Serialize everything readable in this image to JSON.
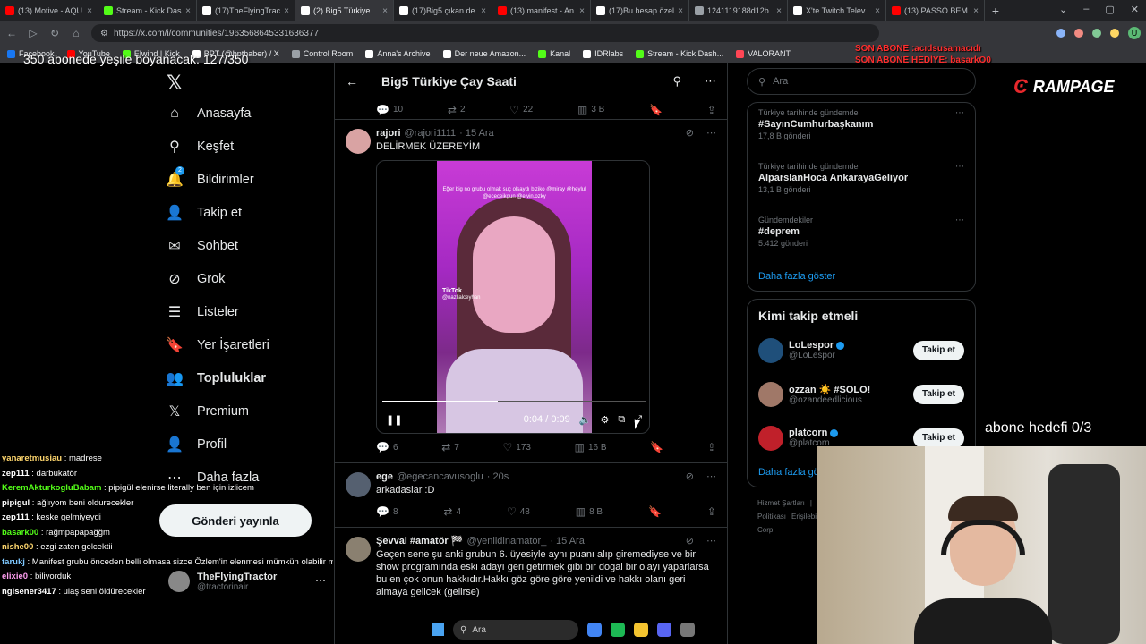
{
  "browser": {
    "tabs": [
      {
        "label": "(13) Motive - AQU",
        "color": "#ff0000"
      },
      {
        "label": "Stream - Kick Dash",
        "color": "#53fc18"
      },
      {
        "label": "(17)TheFlyingTrac",
        "color": "#ffffff"
      },
      {
        "label": "(2) Big5 Türkiye",
        "color": "#ffffff"
      },
      {
        "label": "(17)Big5 çıkan de",
        "color": "#ffffff"
      },
      {
        "label": "(13) manifest - An",
        "color": "#ff0000"
      },
      {
        "label": "(17)Bu hesap özel",
        "color": "#ffffff"
      },
      {
        "label": "1241119188d12b",
        "color": "#9aa0a6"
      },
      {
        "label": "X'te Twitch Telev",
        "color": "#ffffff"
      },
      {
        "label": "(13) PASSO BEM",
        "color": "#ff0000"
      }
    ],
    "active_tab": 3,
    "url": "https://x.com/i/communities/1963568645331636377",
    "bookmarks": [
      {
        "label": "Facebook",
        "color": "#1877f2"
      },
      {
        "label": "YouTube",
        "color": "#ff0000"
      },
      {
        "label": "Elwind | Kick",
        "color": "#53fc18"
      },
      {
        "label": "BPT (@bpthaber) / X",
        "color": "#ffffff"
      },
      {
        "label": "Control Room",
        "color": "#9aa0a6"
      },
      {
        "label": "Anna's Archive",
        "color": "#ffffff"
      },
      {
        "label": "Der neue Amazon...",
        "color": "#ffffff"
      },
      {
        "label": "Kanal",
        "color": "#53fc18"
      },
      {
        "label": "IDRlabs",
        "color": "#ffffff"
      },
      {
        "label": "Stream - Kick Dash...",
        "color": "#53fc18"
      },
      {
        "label": "VALORANT",
        "color": "#ff4655"
      }
    ]
  },
  "nav": {
    "items": [
      {
        "label": "Anasayfa",
        "icon": "home-icon",
        "glyph": "⌂"
      },
      {
        "label": "Keşfet",
        "icon": "search-icon",
        "glyph": "⚲"
      },
      {
        "label": "Bildirimler",
        "icon": "bell-icon",
        "glyph": "🔔"
      },
      {
        "label": "Takip et",
        "icon": "follow-icon",
        "glyph": "👤"
      },
      {
        "label": "Sohbet",
        "icon": "mail-icon",
        "glyph": "✉"
      },
      {
        "label": "Grok",
        "icon": "grok-icon",
        "glyph": "⊘"
      },
      {
        "label": "Listeler",
        "icon": "list-icon",
        "glyph": "☰"
      },
      {
        "label": "Yer İşaretleri",
        "icon": "bookmark-icon",
        "glyph": "🔖"
      },
      {
        "label": "Topluluklar",
        "icon": "communities-icon",
        "glyph": "👥"
      },
      {
        "label": "Premium",
        "icon": "x-icon",
        "glyph": "𝕏"
      },
      {
        "label": "Profil",
        "icon": "profile-icon",
        "glyph": "👤"
      },
      {
        "label": "Daha fazla",
        "icon": "more-icon",
        "glyph": "⋯"
      }
    ],
    "notif_count": "2",
    "post_button": "Gönderi yayınla",
    "account": {
      "name": "TheFlyingTractor",
      "handle": "@tractorinair"
    }
  },
  "center": {
    "title": "Big5 Türkiye Çay Saati",
    "prev_actions": {
      "reply": "10",
      "repost": "2",
      "like": "22",
      "views": "3 B"
    },
    "tweets": [
      {
        "name": "rajori",
        "handle": "@rajori1111",
        "time": "· 15 Ara",
        "text": "DELİRMEK ÜZEREYİM",
        "avatar_color": "#d9a3a3",
        "video": {
          "caption": "Eğer big no grubu olmak suç olsaydı biziko @miray @heylul @ececeikgun @elvin.ozky",
          "tiktok": "TikTok",
          "tiktok_handle": "@nazlialceyhan",
          "time": "0:04 / 0:09",
          "progress": 0.44
        },
        "actions": {
          "reply": "6",
          "repost": "7",
          "like": "173",
          "views": "16 B"
        }
      },
      {
        "name": "ege",
        "handle": "@egecancavusoglu",
        "time": "· 20s",
        "text": "arkadaslar :D",
        "avatar_color": "#556070",
        "actions": {
          "reply": "8",
          "repost": "4",
          "like": "48",
          "views": "8 B"
        }
      },
      {
        "name": "Şevval #amatör 🏁",
        "handle": "@yenildinamator_",
        "time": "· 15 Ara",
        "text": "Geçen sene şu anki grubun 6. üyesiyle aynı puanı alıp giremediyse ve bir show programında eski adayı geri getirmek gibi bir dogal bir olayı yaparlarsa bu en çok onun hakkıdır.Hakkı göz göre göre yenildi ve hakkı olanı geri almaya gelicek (gelirse)",
        "avatar_color": "#8a8070"
      }
    ]
  },
  "right": {
    "search_placeholder": "Ara",
    "trends": [
      {
        "context": "Türkiye tarihinde gündemde",
        "title": "#SayınCumhurbaşkanım",
        "count": "17,8 B gönderi"
      },
      {
        "context": "Türkiye tarihinde gündemde",
        "title": "AlparslanHoca AnkarayaGeliyor",
        "count": "13,1 B gönderi"
      },
      {
        "context": "Gündemdekiler",
        "title": "#deprem",
        "count": "5.412 gönderi"
      }
    ],
    "show_more": "Daha fazla göster",
    "who_to_follow_title": "Kimi takip etmeli",
    "follow": [
      {
        "name": "LoLespor",
        "handle": "@LoLespor",
        "verified": true,
        "avatar_color": "#1f4f7a"
      },
      {
        "name": "ozzan ☀️ #SOLO!",
        "handle": "@ozandeedlicious",
        "verified": false,
        "avatar_color": "#a07868"
      },
      {
        "name": "platcorn",
        "handle": "@platcorn",
        "verified": true,
        "avatar_color": "#c0202a"
      }
    ],
    "follow_button": "Takip et",
    "show_more2": "Daha fazla göster",
    "footer": [
      "Hizmet Şartları",
      "|",
      "Gizlilik Politikası",
      "Çerez Politikası",
      "Erişilebilirlik",
      "Reklam bilgisi",
      "Daha fazla ...",
      "© 2025 X Corp."
    ]
  },
  "overlay": {
    "top_text": "350 abonede yeşile boyanacak: 127/350",
    "sub_last": "SON ABONE :acıdsusamacıdı",
    "sub_gift": "SON ABONE HEDİYE: basarkO0",
    "brand": "RAMPAGE",
    "goal": "abone hedefi 0/3"
  },
  "chat": [
    {
      "user": "yanaretmusiau",
      "msg": " : madrese",
      "color": "#ffd76e"
    },
    {
      "user": "zep111",
      "msg": " : darbukatör",
      "color": "#ffffff"
    },
    {
      "user": "KeremAkturkogluBabam",
      "msg": " : pipigül elenirse literally ben için izlicem",
      "color": "#53fc18"
    },
    {
      "user": "pipigul",
      "msg": " : ağlıyom beni oldurecekler",
      "color": "#ffffff"
    },
    {
      "user": "zep111",
      "msg": " : keske gelmiyeydi",
      "color": "#ffffff"
    },
    {
      "user": "basark00",
      "msg": " : rağmpapapağğm",
      "color": "#53fc18"
    },
    {
      "user": "nishe00",
      "msg": " : ezgi zaten gelcektii",
      "color": "#ffd76e"
    },
    {
      "user": "farukj",
      "msg": " : Manifest grubu önceden belli olmasa sizce Özlem'in elenmesi mümkün olabilir miydi? (final performansında :D",
      "color": "#7ec8ff"
    },
    {
      "user": "elixie0",
      "msg": " : biliyorduk",
      "color": "#ff9ef0"
    },
    {
      "user": "nglsener3417",
      "msg": " : ulaş seni öldürecekler",
      "color": "#ffffff"
    }
  ],
  "taskbar": {
    "search": "Ara"
  }
}
